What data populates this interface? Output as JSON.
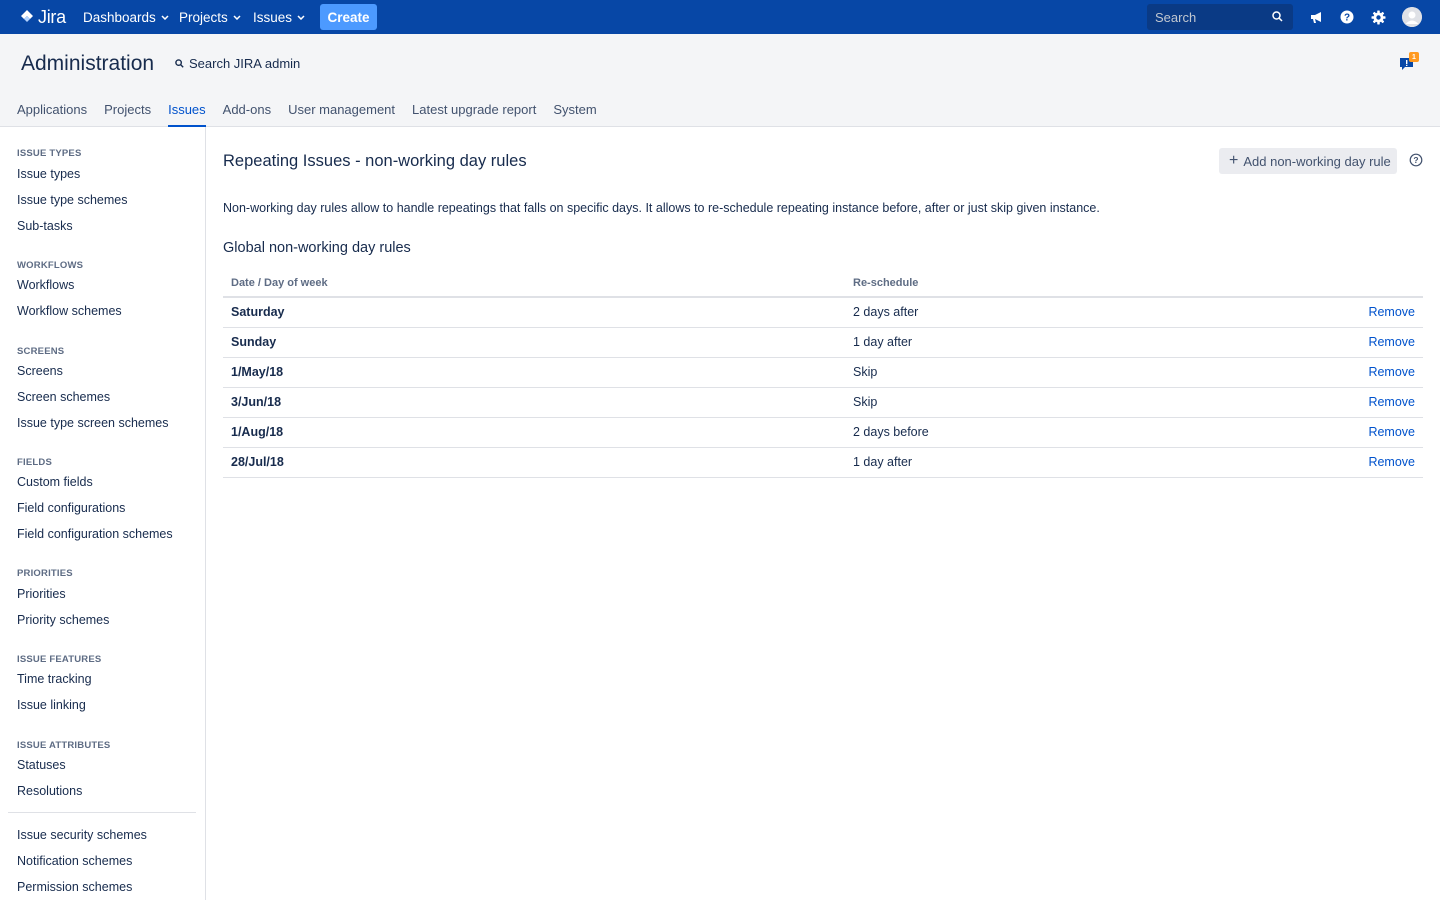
{
  "topnav": {
    "logo_text": "Jira",
    "menus": [
      {
        "label": "Dashboards"
      },
      {
        "label": "Projects"
      },
      {
        "label": "Issues"
      }
    ],
    "create_label": "Create",
    "search_placeholder": "Search",
    "icons": [
      "megaphone-icon",
      "help-icon",
      "gear-icon",
      "avatar"
    ]
  },
  "admin": {
    "title": "Administration",
    "search_label": "Search JIRA admin",
    "notification_count": "1",
    "tabs": [
      {
        "label": "Applications"
      },
      {
        "label": "Projects"
      },
      {
        "label": "Issues"
      },
      {
        "label": "Add-ons"
      },
      {
        "label": "User management"
      },
      {
        "label": "Latest upgrade report"
      },
      {
        "label": "System"
      }
    ],
    "active_tab": "Issues"
  },
  "sidebar": {
    "sections": [
      {
        "heading": "ISSUE TYPES",
        "items": [
          "Issue types",
          "Issue type schemes",
          "Sub-tasks"
        ]
      },
      {
        "heading": "WORKFLOWS",
        "items": [
          "Workflows",
          "Workflow schemes"
        ]
      },
      {
        "heading": "SCREENS",
        "items": [
          "Screens",
          "Screen schemes",
          "Issue type screen schemes"
        ]
      },
      {
        "heading": "FIELDS",
        "items": [
          "Custom fields",
          "Field configurations",
          "Field configuration schemes"
        ]
      },
      {
        "heading": "PRIORITIES",
        "items": [
          "Priorities",
          "Priority schemes"
        ]
      },
      {
        "heading": "ISSUE FEATURES",
        "items": [
          "Time tracking",
          "Issue linking"
        ]
      },
      {
        "heading": "ISSUE ATTRIBUTES",
        "items": [
          "Statuses",
          "Resolutions"
        ]
      }
    ],
    "footer_items": [
      "Issue security schemes",
      "Notification schemes",
      "Permission schemes"
    ]
  },
  "main": {
    "title": "Repeating Issues - non-working day rules",
    "add_button_label": "Add non-working day rule",
    "description": "Non-working day rules allow to handle repeatings that falls on specific days. It allows to re-schedule repeating instance before, after or just skip given instance.",
    "section_title": "Global non-working day rules",
    "table": {
      "columns": [
        "Date / Day of week",
        "Re-schedule",
        ""
      ],
      "rows": [
        {
          "date": "Saturday",
          "reschedule": "2 days after",
          "action": "Remove"
        },
        {
          "date": "Sunday",
          "reschedule": "1 day after",
          "action": "Remove"
        },
        {
          "date": "1/May/18",
          "reschedule": "Skip",
          "action": "Remove"
        },
        {
          "date": "3/Jun/18",
          "reschedule": "Skip",
          "action": "Remove"
        },
        {
          "date": "1/Aug/18",
          "reschedule": "2 days before",
          "action": "Remove"
        },
        {
          "date": "28/Jul/18",
          "reschedule": "1 day after",
          "action": "Remove"
        }
      ]
    }
  }
}
